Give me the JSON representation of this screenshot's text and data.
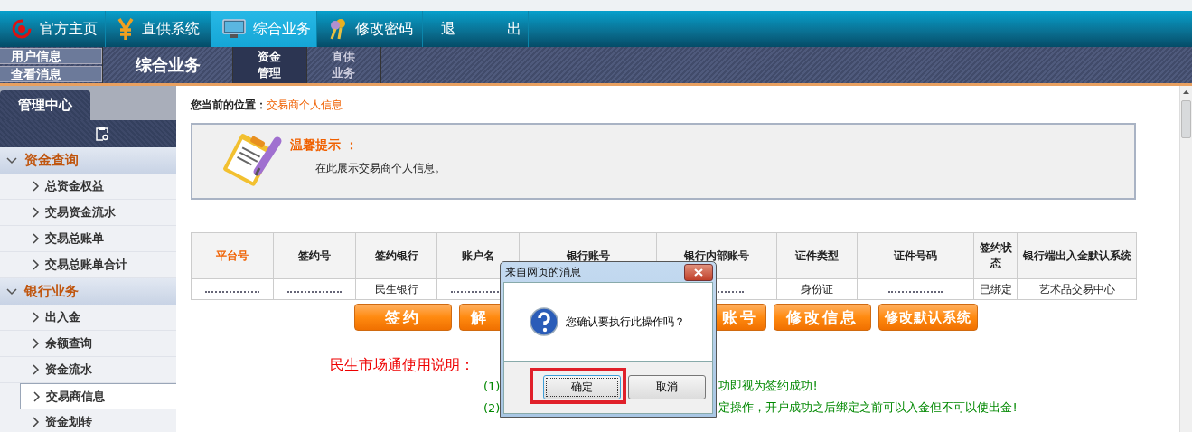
{
  "nav": {
    "items": [
      {
        "label": "官方主页",
        "kind": "home",
        "selected": false
      },
      {
        "label": "直供系统",
        "kind": "supply",
        "selected": false
      },
      {
        "label": "综合业务",
        "kind": "business",
        "selected": true
      },
      {
        "label": "修改密码",
        "kind": "password",
        "selected": false
      },
      {
        "label": "退 出",
        "kind": "logout",
        "selected": false
      }
    ]
  },
  "subbar": {
    "user_buttons": [
      "用户信息",
      "查看消息"
    ],
    "section_title": "综合业务",
    "tabs": [
      {
        "label": "资金管理",
        "selected": true
      },
      {
        "label": "直供业务",
        "selected": false
      }
    ]
  },
  "sidebar": {
    "tab": "管理中心",
    "groups": [
      {
        "title": "资金查询",
        "expanded": true,
        "items": [
          {
            "label": "总资金权益",
            "selected": false
          },
          {
            "label": "交易资金流水",
            "selected": false
          },
          {
            "label": "交易总账单",
            "selected": false
          },
          {
            "label": "交易总账单合计",
            "selected": false
          }
        ]
      },
      {
        "title": "银行业务",
        "expanded": true,
        "items": [
          {
            "label": "出入金",
            "selected": false
          },
          {
            "label": "余额查询",
            "selected": false
          },
          {
            "label": "资金流水",
            "selected": false
          },
          {
            "label": "交易商信息",
            "selected": true
          },
          {
            "label": "资金划转",
            "selected": false
          }
        ]
      }
    ]
  },
  "breadcrumb": {
    "label": "您当前的位置：",
    "value": "交易商个人信息"
  },
  "tip": {
    "title": "温馨提示 ：",
    "text": "在此展示交易商个人信息。"
  },
  "table": {
    "columns": [
      {
        "label": "平台号",
        "highlighted": true
      },
      {
        "label": "签约号",
        "highlighted": false
      },
      {
        "label": "签约银行",
        "highlighted": false
      },
      {
        "label": "账户名",
        "highlighted": false
      },
      {
        "label": "银行账号",
        "highlighted": false
      },
      {
        "label": "银行内部账号",
        "highlighted": false
      },
      {
        "label": "证件类型",
        "highlighted": false
      },
      {
        "label": "证件号码",
        "highlighted": false
      },
      {
        "label": "签约状态",
        "highlighted": false
      },
      {
        "label": "银行端出入金默认系统",
        "highlighted": false
      }
    ],
    "rows": [
      {
        "cells": [
          null,
          null,
          "民生银行",
          null,
          null,
          null,
          "身份证",
          null,
          "已绑定",
          "艺术品交易中心"
        ]
      }
    ]
  },
  "buttons": [
    {
      "label": "签约",
      "kind": "full"
    },
    {
      "label": "解",
      "kind": "cut_right"
    },
    {
      "kind": "hidden"
    },
    {
      "label": "账号",
      "kind": "cut_left"
    },
    {
      "label": "修改信息",
      "kind": "full"
    },
    {
      "label": "修改默认系统",
      "kind": "full"
    }
  ],
  "instructions": {
    "title": "民生市场通使用说明：",
    "lines": [
      {
        "number": "(1)",
        "text": "功即视为签约成功!"
      },
      {
        "number": "(2)",
        "text": "定操作，开户成功之后绑定之前可以入金但不可以使出金!"
      }
    ]
  },
  "dialog": {
    "title": "来自网页的消息",
    "message": "您确认要执行此操作吗？",
    "buttons": [
      {
        "label": "确定",
        "focused": true
      },
      {
        "label": "取消",
        "focused": false
      }
    ]
  }
}
